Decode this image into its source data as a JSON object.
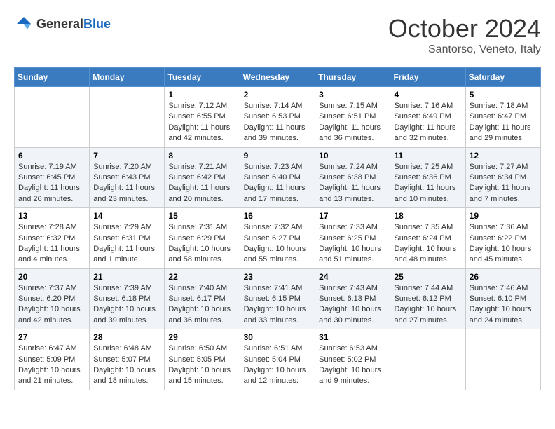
{
  "header": {
    "logo_general": "General",
    "logo_blue": "Blue",
    "month": "October 2024",
    "location": "Santorso, Veneto, Italy"
  },
  "weekdays": [
    "Sunday",
    "Monday",
    "Tuesday",
    "Wednesday",
    "Thursday",
    "Friday",
    "Saturday"
  ],
  "weeks": [
    [
      {
        "day": "",
        "sunrise": "",
        "sunset": "",
        "daylight": ""
      },
      {
        "day": "",
        "sunrise": "",
        "sunset": "",
        "daylight": ""
      },
      {
        "day": "1",
        "sunrise": "Sunrise: 7:12 AM",
        "sunset": "Sunset: 6:55 PM",
        "daylight": "Daylight: 11 hours and 42 minutes."
      },
      {
        "day": "2",
        "sunrise": "Sunrise: 7:14 AM",
        "sunset": "Sunset: 6:53 PM",
        "daylight": "Daylight: 11 hours and 39 minutes."
      },
      {
        "day": "3",
        "sunrise": "Sunrise: 7:15 AM",
        "sunset": "Sunset: 6:51 PM",
        "daylight": "Daylight: 11 hours and 36 minutes."
      },
      {
        "day": "4",
        "sunrise": "Sunrise: 7:16 AM",
        "sunset": "Sunset: 6:49 PM",
        "daylight": "Daylight: 11 hours and 32 minutes."
      },
      {
        "day": "5",
        "sunrise": "Sunrise: 7:18 AM",
        "sunset": "Sunset: 6:47 PM",
        "daylight": "Daylight: 11 hours and 29 minutes."
      }
    ],
    [
      {
        "day": "6",
        "sunrise": "Sunrise: 7:19 AM",
        "sunset": "Sunset: 6:45 PM",
        "daylight": "Daylight: 11 hours and 26 minutes."
      },
      {
        "day": "7",
        "sunrise": "Sunrise: 7:20 AM",
        "sunset": "Sunset: 6:43 PM",
        "daylight": "Daylight: 11 hours and 23 minutes."
      },
      {
        "day": "8",
        "sunrise": "Sunrise: 7:21 AM",
        "sunset": "Sunset: 6:42 PM",
        "daylight": "Daylight: 11 hours and 20 minutes."
      },
      {
        "day": "9",
        "sunrise": "Sunrise: 7:23 AM",
        "sunset": "Sunset: 6:40 PM",
        "daylight": "Daylight: 11 hours and 17 minutes."
      },
      {
        "day": "10",
        "sunrise": "Sunrise: 7:24 AM",
        "sunset": "Sunset: 6:38 PM",
        "daylight": "Daylight: 11 hours and 13 minutes."
      },
      {
        "day": "11",
        "sunrise": "Sunrise: 7:25 AM",
        "sunset": "Sunset: 6:36 PM",
        "daylight": "Daylight: 11 hours and 10 minutes."
      },
      {
        "day": "12",
        "sunrise": "Sunrise: 7:27 AM",
        "sunset": "Sunset: 6:34 PM",
        "daylight": "Daylight: 11 hours and 7 minutes."
      }
    ],
    [
      {
        "day": "13",
        "sunrise": "Sunrise: 7:28 AM",
        "sunset": "Sunset: 6:32 PM",
        "daylight": "Daylight: 11 hours and 4 minutes."
      },
      {
        "day": "14",
        "sunrise": "Sunrise: 7:29 AM",
        "sunset": "Sunset: 6:31 PM",
        "daylight": "Daylight: 11 hours and 1 minute."
      },
      {
        "day": "15",
        "sunrise": "Sunrise: 7:31 AM",
        "sunset": "Sunset: 6:29 PM",
        "daylight": "Daylight: 10 hours and 58 minutes."
      },
      {
        "day": "16",
        "sunrise": "Sunrise: 7:32 AM",
        "sunset": "Sunset: 6:27 PM",
        "daylight": "Daylight: 10 hours and 55 minutes."
      },
      {
        "day": "17",
        "sunrise": "Sunrise: 7:33 AM",
        "sunset": "Sunset: 6:25 PM",
        "daylight": "Daylight: 10 hours and 51 minutes."
      },
      {
        "day": "18",
        "sunrise": "Sunrise: 7:35 AM",
        "sunset": "Sunset: 6:24 PM",
        "daylight": "Daylight: 10 hours and 48 minutes."
      },
      {
        "day": "19",
        "sunrise": "Sunrise: 7:36 AM",
        "sunset": "Sunset: 6:22 PM",
        "daylight": "Daylight: 10 hours and 45 minutes."
      }
    ],
    [
      {
        "day": "20",
        "sunrise": "Sunrise: 7:37 AM",
        "sunset": "Sunset: 6:20 PM",
        "daylight": "Daylight: 10 hours and 42 minutes."
      },
      {
        "day": "21",
        "sunrise": "Sunrise: 7:39 AM",
        "sunset": "Sunset: 6:18 PM",
        "daylight": "Daylight: 10 hours and 39 minutes."
      },
      {
        "day": "22",
        "sunrise": "Sunrise: 7:40 AM",
        "sunset": "Sunset: 6:17 PM",
        "daylight": "Daylight: 10 hours and 36 minutes."
      },
      {
        "day": "23",
        "sunrise": "Sunrise: 7:41 AM",
        "sunset": "Sunset: 6:15 PM",
        "daylight": "Daylight: 10 hours and 33 minutes."
      },
      {
        "day": "24",
        "sunrise": "Sunrise: 7:43 AM",
        "sunset": "Sunset: 6:13 PM",
        "daylight": "Daylight: 10 hours and 30 minutes."
      },
      {
        "day": "25",
        "sunrise": "Sunrise: 7:44 AM",
        "sunset": "Sunset: 6:12 PM",
        "daylight": "Daylight: 10 hours and 27 minutes."
      },
      {
        "day": "26",
        "sunrise": "Sunrise: 7:46 AM",
        "sunset": "Sunset: 6:10 PM",
        "daylight": "Daylight: 10 hours and 24 minutes."
      }
    ],
    [
      {
        "day": "27",
        "sunrise": "Sunrise: 6:47 AM",
        "sunset": "Sunset: 5:09 PM",
        "daylight": "Daylight: 10 hours and 21 minutes."
      },
      {
        "day": "28",
        "sunrise": "Sunrise: 6:48 AM",
        "sunset": "Sunset: 5:07 PM",
        "daylight": "Daylight: 10 hours and 18 minutes."
      },
      {
        "day": "29",
        "sunrise": "Sunrise: 6:50 AM",
        "sunset": "Sunset: 5:05 PM",
        "daylight": "Daylight: 10 hours and 15 minutes."
      },
      {
        "day": "30",
        "sunrise": "Sunrise: 6:51 AM",
        "sunset": "Sunset: 5:04 PM",
        "daylight": "Daylight: 10 hours and 12 minutes."
      },
      {
        "day": "31",
        "sunrise": "Sunrise: 6:53 AM",
        "sunset": "Sunset: 5:02 PM",
        "daylight": "Daylight: 10 hours and 9 minutes."
      },
      {
        "day": "",
        "sunrise": "",
        "sunset": "",
        "daylight": ""
      },
      {
        "day": "",
        "sunrise": "",
        "sunset": "",
        "daylight": ""
      }
    ]
  ]
}
